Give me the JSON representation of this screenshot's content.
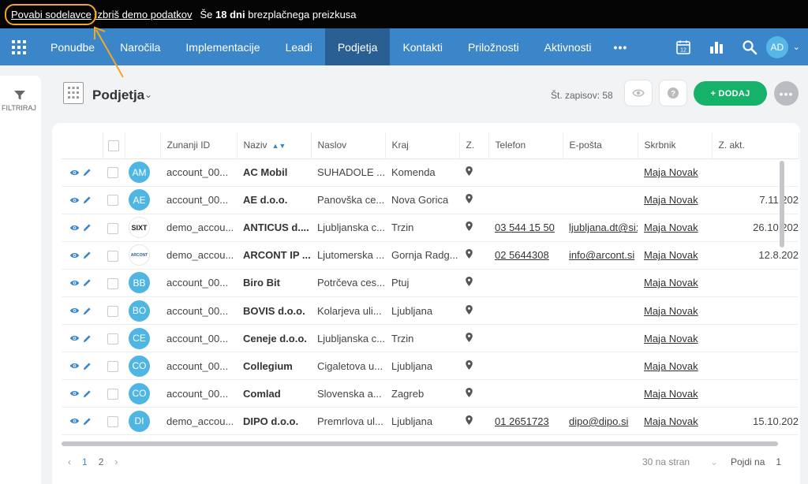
{
  "topbar": {
    "invite": "Povabi sodelavce",
    "delete_demo": "Izbriš demo podatkov",
    "trial_prefix": "Še",
    "trial_days": "18 dni",
    "trial_suffix": "brezplačnega preizkusa"
  },
  "nav": {
    "items": [
      "Ponudbe",
      "Naročila",
      "Implementacije",
      "Leadi",
      "Podjetja",
      "Kontakti",
      "Priložnosti",
      "Aktivnosti"
    ],
    "active": "Podjetja",
    "more": "•••",
    "calendar_day": "12",
    "user_initials": "AD"
  },
  "filter": {
    "label": "FILTRIRAJ"
  },
  "page": {
    "title": "Podjetja",
    "record_count": "Št. zapisov: 58",
    "add_label": "+ DODAJ"
  },
  "table": {
    "headers": [
      "Zunanji ID",
      "Naziv",
      "Naslov",
      "Kraj",
      "Z.",
      "Telefon",
      "E-pošta",
      "Skrbnik",
      "Z. akt."
    ],
    "rows": [
      {
        "avatar": "AM",
        "id": "account_00...",
        "name": "AC Mobil",
        "address": "SUHADOLE ...",
        "city": "Komenda",
        "phone": "",
        "email": "",
        "owner": "Maja Novak",
        "last": ""
      },
      {
        "avatar": "AE",
        "id": "account_00...",
        "name": "AE d.o.o.",
        "address": "Panovška ce...",
        "city": "Nova Gorica",
        "phone": "",
        "email": "",
        "owner": "Maja Novak",
        "last": "7.11.202"
      },
      {
        "avatar": "SIXT",
        "id": "demo_accou...",
        "name": "ANTICUS d....",
        "address": "Ljubljanska c...",
        "city": "Trzin",
        "phone": "03 544 15 50",
        "email": "ljubljana.dt@si:",
        "owner": "Maja Novak",
        "last": "26.10.202"
      },
      {
        "avatar": "ARCONT",
        "id": "demo_accou...",
        "name": "ARCONT IP ...",
        "address": "Ljutomerska ...",
        "city": "Gornja Radg...",
        "phone": "02 5644308",
        "email": "info@arcont.si",
        "owner": "Maja Novak",
        "last": "12.8.202"
      },
      {
        "avatar": "BB",
        "id": "account_00...",
        "name": "Biro Bit",
        "address": "Potrčeva ces...",
        "city": "Ptuj",
        "phone": "",
        "email": "",
        "owner": "Maja Novak",
        "last": ""
      },
      {
        "avatar": "BO",
        "id": "account_00...",
        "name": "BOVIS d.o.o.",
        "address": "Kolarjeva uli...",
        "city": "Ljubljana",
        "phone": "",
        "email": "",
        "owner": "Maja Novak",
        "last": ""
      },
      {
        "avatar": "CE",
        "id": "account_00...",
        "name": "Ceneje d.o.o.",
        "address": "Ljubljanska c...",
        "city": "Trzin",
        "phone": "",
        "email": "",
        "owner": "Maja Novak",
        "last": ""
      },
      {
        "avatar": "CO",
        "id": "account_00...",
        "name": "Collegium",
        "address": "Cigaletova u...",
        "city": "Ljubljana",
        "phone": "",
        "email": "",
        "owner": "Maja Novak",
        "last": ""
      },
      {
        "avatar": "CO",
        "id": "account_00...",
        "name": "Comlad",
        "address": "Slovenska a...",
        "city": "Zagreb",
        "phone": "",
        "email": "",
        "owner": "Maja Novak",
        "last": ""
      },
      {
        "avatar": "DI",
        "id": "demo_accou...",
        "name": "DIPO d.o.o.",
        "address": "Premrlova ul...",
        "city": "Ljubljana",
        "phone": "01 2651723",
        "email": "dipo@dipo.si",
        "owner": "Maja Novak",
        "last": "15.10.202"
      }
    ]
  },
  "pager": {
    "pages": [
      "1",
      "2"
    ],
    "per_page": "30 na stran",
    "goto_label": "Pojdi na",
    "goto_value": "1"
  },
  "colors": {
    "nav": "#3b86c8",
    "nav_active": "#2a5f93",
    "add": "#17b26a",
    "avatar": "#4fb5e3",
    "highlight": "#f5a623"
  }
}
